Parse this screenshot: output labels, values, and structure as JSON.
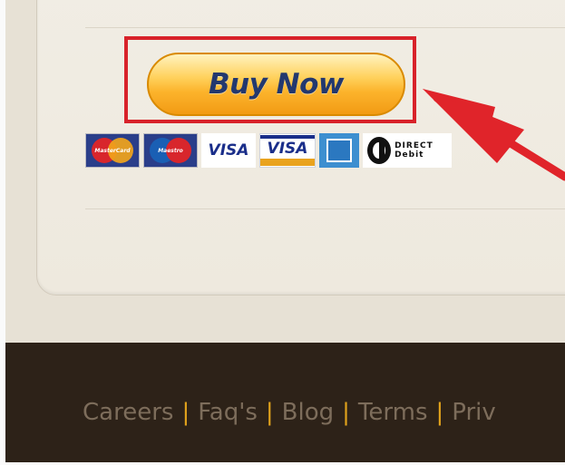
{
  "checkout": {
    "buy_button_label": "Buy Now"
  },
  "payment_methods": [
    {
      "name": "MasterCard",
      "label": "MasterCard"
    },
    {
      "name": "Maestro",
      "label": "Maestro"
    },
    {
      "name": "Visa",
      "label": "VISA"
    },
    {
      "name": "Visa Electron",
      "label": "VISA"
    },
    {
      "name": "American Express",
      "label": ""
    },
    {
      "name": "Direct Debit",
      "label": "DIRECT Debit"
    }
  ],
  "footer": {
    "links": [
      "Careers",
      "Faq's",
      "Blog",
      "Terms",
      "Priv"
    ],
    "separator": "|"
  },
  "colors": {
    "highlight": "#d8222a",
    "arrow": "#e0242a",
    "button": "#fcb42c",
    "footer_bg": "#2d2218",
    "separator": "#e0a21c"
  },
  "icons": [
    "mastercard-logo",
    "maestro-logo",
    "visa-logo",
    "visa-electron-logo",
    "amex-logo",
    "direct-debit-logo",
    "red-arrow"
  ]
}
